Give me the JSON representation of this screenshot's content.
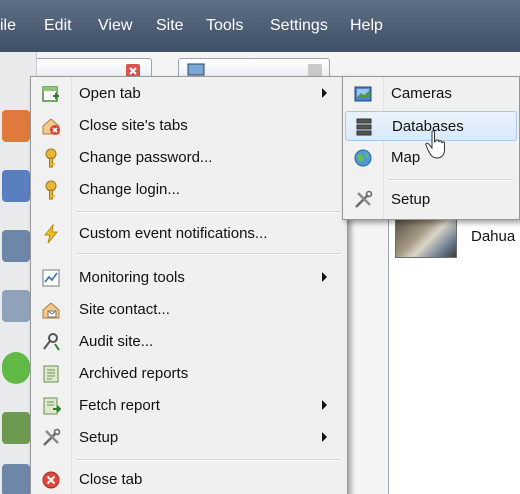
{
  "menubar": {
    "items": [
      "ile",
      "Edit",
      "View",
      "Site",
      "Tools",
      "Settings",
      "Help"
    ]
  },
  "context_menu": {
    "items": [
      {
        "label": "Open tab",
        "icon": "new-tab-icon",
        "submenu": true
      },
      {
        "label": "Close site's tabs",
        "icon": "close-tabs-icon",
        "submenu": false
      },
      {
        "label": "Change password...",
        "icon": "key-icon",
        "submenu": false
      },
      {
        "label": "Change login...",
        "icon": "key-icon",
        "submenu": false
      },
      {
        "label": "Custom event notifications...",
        "icon": "lightning-icon",
        "submenu": false
      },
      {
        "label": "Monitoring tools",
        "icon": "chart-icon",
        "submenu": true
      },
      {
        "label": "Site contact...",
        "icon": "contact-icon",
        "submenu": false
      },
      {
        "label": "Audit site...",
        "icon": "audit-icon",
        "submenu": false
      },
      {
        "label": "Archived reports",
        "icon": "report-icon",
        "submenu": false
      },
      {
        "label": "Fetch report",
        "icon": "fetch-report-icon",
        "submenu": true
      },
      {
        "label": "Setup",
        "icon": "tools-icon",
        "submenu": true
      },
      {
        "label": "Close tab",
        "icon": "close-icon",
        "submenu": false
      }
    ]
  },
  "submenu": {
    "items": [
      {
        "label": "Cameras",
        "icon": "camera-icon"
      },
      {
        "label": "Databases",
        "icon": "database-icon",
        "highlighted": true
      },
      {
        "label": "Map",
        "icon": "globe-icon"
      },
      {
        "label": "Setup",
        "icon": "tools-icon"
      }
    ]
  },
  "camera_list": {
    "items": [
      {
        "label": "Dahua"
      }
    ]
  },
  "colors": {
    "menubar": "#4a5a70",
    "menu_bg": "#f0f0f0",
    "highlight": "#d9e9f9",
    "highlight_border": "#a9c9ec"
  }
}
